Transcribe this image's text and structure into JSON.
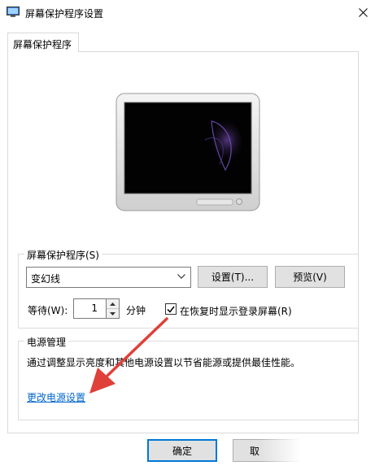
{
  "window": {
    "title": "屏幕保护程序设置"
  },
  "tab": {
    "label": "屏幕保护程序"
  },
  "screensaver": {
    "group_label": "屏幕保护程序(S)",
    "selected": "变幻线",
    "settings_button": "设置(T)...",
    "preview_button": "预览(V)",
    "wait_label": "等待(W):",
    "wait_value": "1",
    "wait_unit": "分钟",
    "resume_checkbox": {
      "label": "在恢复时显示登录屏幕(R)",
      "checked": true
    }
  },
  "power": {
    "group_label": "电源管理",
    "description": "通过调整显示亮度和其他电源设置以节省能源或提供最佳性能。",
    "link": "更改电源设置"
  },
  "footer": {
    "ok_button": "确定",
    "partial_button": "取"
  },
  "colors": {
    "accent": "#0078d7",
    "link": "#0066cc",
    "annotation_arrow": "#e0403a"
  }
}
